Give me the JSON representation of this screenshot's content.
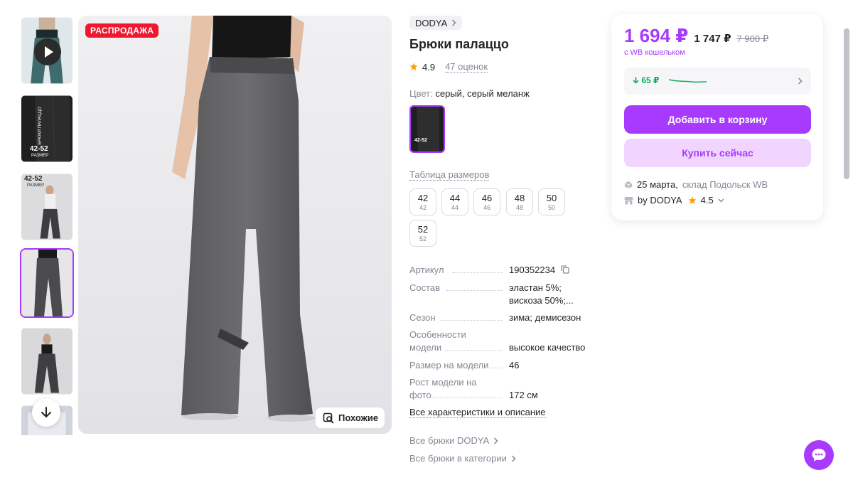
{
  "gallery": {
    "sale_badge": "РАСПРОДАЖА",
    "similar_label": "Похожие",
    "thumb_text": {
      "size_range": "42-52",
      "size_word": "РАЗМЕР",
      "vertical": "БРЮКИ ПАЛАЦЦО"
    }
  },
  "product": {
    "brand": "DODYA",
    "title": "Брюки палаццо",
    "rating": "4.9",
    "reviews": "47 оценок",
    "color_label": "Цвет:",
    "color_value": "серый, серый меланж",
    "swatch_text": "42-52",
    "size_table": "Таблица размеров",
    "sizes": [
      {
        "ru": "42",
        "intl": "42"
      },
      {
        "ru": "44",
        "intl": "44"
      },
      {
        "ru": "46",
        "intl": "46"
      },
      {
        "ru": "48",
        "intl": "48"
      },
      {
        "ru": "50",
        "intl": "50"
      },
      {
        "ru": "52",
        "intl": "52"
      }
    ],
    "specs": [
      {
        "key": "Артикул",
        "value": "190352234"
      },
      {
        "key": "Состав",
        "value": "эластан 5%; вискоза 50%;..."
      },
      {
        "key": "Сезон",
        "value": "зима; демисезон"
      },
      {
        "key": "Особенности модели",
        "value": "высокое качество"
      },
      {
        "key": "Размер на модели",
        "value": "46"
      },
      {
        "key": "Рост модели на фото",
        "value": "172 см"
      }
    ],
    "all_specs": "Все характеристики и описание",
    "link_brand": "Все брюки DODYA",
    "link_category": "Все брюки в категории"
  },
  "card": {
    "price_main": "1 694 ₽",
    "price_mid": "1 747 ₽",
    "price_old": "7 900 ₽",
    "wallet_note": "с WB кошельком",
    "price_drop": "65 ₽",
    "add_to_cart": "Добавить в корзину",
    "buy_now": "Купить сейчас",
    "delivery_date": "25 марта,",
    "warehouse": "склад Подольск WB",
    "seller": "by DODYA",
    "seller_rating": "4.5"
  },
  "colors": {
    "accent": "#a73afd",
    "accent_light": "#f1d5ff",
    "sale": "#f0182f",
    "green": "#0dad5f",
    "muted": "#868695"
  },
  "icons": [
    "play-icon",
    "arrow-down-icon",
    "search-similar-icon",
    "chevron-right-icon",
    "star-icon",
    "copy-icon",
    "chevron-down-icon",
    "box-icon",
    "shop-icon",
    "chat-icon",
    "arrow-drop-icon"
  ]
}
